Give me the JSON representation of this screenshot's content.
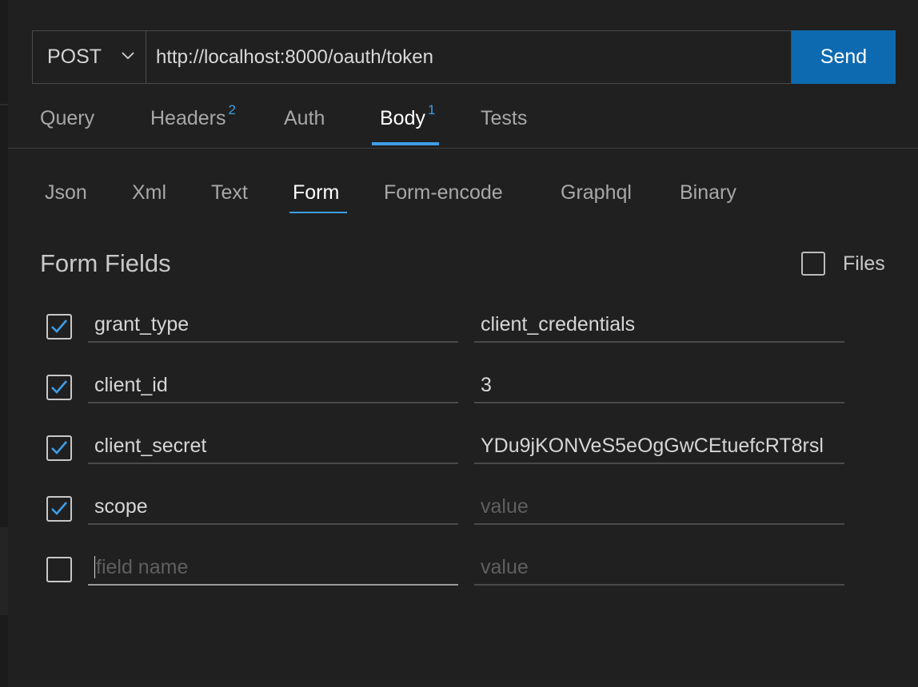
{
  "request": {
    "method": "POST",
    "url": "http://localhost:8000/oauth/token",
    "send_label": "Send"
  },
  "main_tabs": [
    {
      "label": "Query",
      "badge": ""
    },
    {
      "label": "Headers",
      "badge": "2"
    },
    {
      "label": "Auth",
      "badge": ""
    },
    {
      "label": "Body",
      "badge": "1"
    },
    {
      "label": "Tests",
      "badge": ""
    }
  ],
  "active_main_tab": "Body",
  "body_tabs": [
    "Json",
    "Xml",
    "Text",
    "Form",
    "Form-encode",
    "Graphql",
    "Binary"
  ],
  "active_body_tab": "Form",
  "form": {
    "title": "Form Fields",
    "files_label": "Files",
    "files_checked": false,
    "rows": [
      {
        "checked": true,
        "name": "grant_type",
        "value": "client_credentials"
      },
      {
        "checked": true,
        "name": "client_id",
        "value": "3"
      },
      {
        "checked": true,
        "name": "client_secret",
        "value": "YDu9jKONVeS5eOgGwCEtuefcRT8rsl"
      },
      {
        "checked": true,
        "name": "scope",
        "value": "",
        "value_placeholder": "value"
      },
      {
        "checked": false,
        "name": "",
        "name_placeholder": "field name",
        "value": "",
        "value_placeholder": "value"
      }
    ]
  },
  "colors": {
    "accent": "#3d9ee8",
    "send_button": "#0e6ab0",
    "background": "#202020"
  }
}
